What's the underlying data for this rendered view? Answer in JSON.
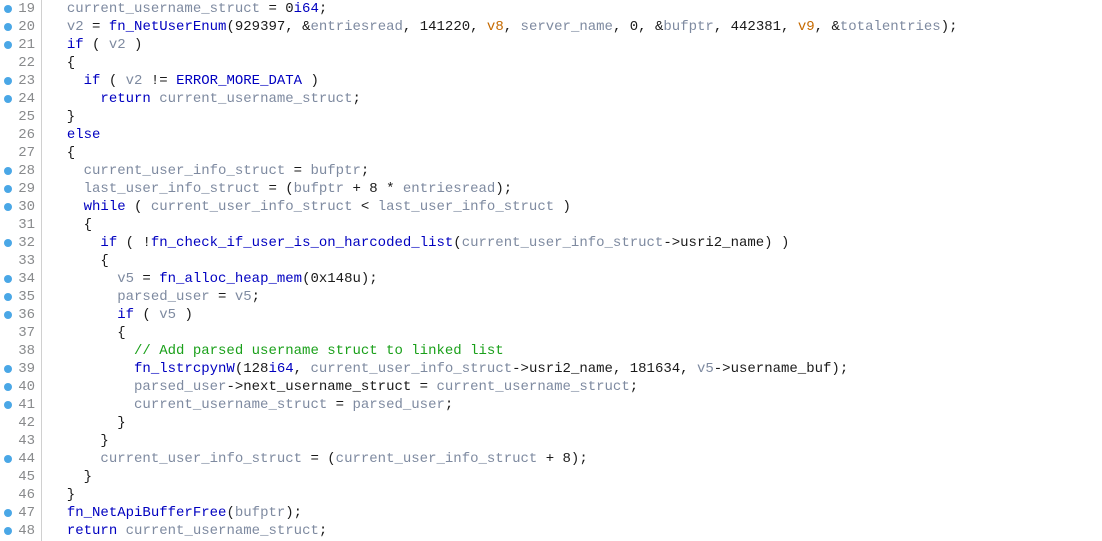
{
  "lines": [
    {
      "num": 19,
      "bp": true,
      "tokens": [
        [
          "  ",
          "sym"
        ],
        [
          "current_username_struct",
          "var"
        ],
        [
          " = 0",
          "sym"
        ],
        [
          "i64",
          "fn"
        ],
        [
          ";",
          "sym"
        ]
      ]
    },
    {
      "num": 20,
      "bp": true,
      "tokens": [
        [
          "  ",
          "sym"
        ],
        [
          "v2",
          "var"
        ],
        [
          " = ",
          "sym"
        ],
        [
          "fn_NetUserEnum",
          "fn"
        ],
        [
          "(929397, &",
          "sym"
        ],
        [
          "entriesread",
          "var"
        ],
        [
          ", 141220, ",
          "sym"
        ],
        [
          "v8",
          "param"
        ],
        [
          ", ",
          "sym"
        ],
        [
          "server_name",
          "var"
        ],
        [
          ", 0, &",
          "sym"
        ],
        [
          "bufptr",
          "var"
        ],
        [
          ", 442381, ",
          "sym"
        ],
        [
          "v9",
          "param"
        ],
        [
          ", &",
          "sym"
        ],
        [
          "totalentries",
          "var"
        ],
        [
          ");",
          "sym"
        ]
      ]
    },
    {
      "num": 21,
      "bp": true,
      "tokens": [
        [
          "  ",
          "sym"
        ],
        [
          "if",
          "kw"
        ],
        [
          " ( ",
          "sym"
        ],
        [
          "v2",
          "var"
        ],
        [
          " )",
          "sym"
        ]
      ]
    },
    {
      "num": 22,
      "bp": false,
      "tokens": [
        [
          "  {",
          "sym"
        ]
      ]
    },
    {
      "num": 23,
      "bp": true,
      "tokens": [
        [
          "    ",
          "sym"
        ],
        [
          "if",
          "kw"
        ],
        [
          " ( ",
          "sym"
        ],
        [
          "v2",
          "var"
        ],
        [
          " != ",
          "sym"
        ],
        [
          "ERROR_MORE_DATA",
          "fn"
        ],
        [
          " )",
          "sym"
        ]
      ]
    },
    {
      "num": 24,
      "bp": true,
      "tokens": [
        [
          "      ",
          "sym"
        ],
        [
          "return",
          "kw"
        ],
        [
          " ",
          "sym"
        ],
        [
          "current_username_struct",
          "var"
        ],
        [
          ";",
          "sym"
        ]
      ]
    },
    {
      "num": 25,
      "bp": false,
      "tokens": [
        [
          "  }",
          "sym"
        ]
      ]
    },
    {
      "num": 26,
      "bp": false,
      "tokens": [
        [
          "  ",
          "sym"
        ],
        [
          "else",
          "kw"
        ]
      ]
    },
    {
      "num": 27,
      "bp": false,
      "tokens": [
        [
          "  {",
          "sym"
        ]
      ]
    },
    {
      "num": 28,
      "bp": true,
      "tokens": [
        [
          "    ",
          "sym"
        ],
        [
          "current_user_info_struct",
          "var"
        ],
        [
          " = ",
          "sym"
        ],
        [
          "bufptr",
          "var"
        ],
        [
          ";",
          "sym"
        ]
      ]
    },
    {
      "num": 29,
      "bp": true,
      "tokens": [
        [
          "    ",
          "sym"
        ],
        [
          "last_user_info_struct",
          "var"
        ],
        [
          " = (",
          "sym"
        ],
        [
          "bufptr",
          "var"
        ],
        [
          " + 8 * ",
          "sym"
        ],
        [
          "entriesread",
          "var"
        ],
        [
          ");",
          "sym"
        ]
      ]
    },
    {
      "num": 30,
      "bp": true,
      "tokens": [
        [
          "    ",
          "sym"
        ],
        [
          "while",
          "kw"
        ],
        [
          " ( ",
          "sym"
        ],
        [
          "current_user_info_struct",
          "var"
        ],
        [
          " < ",
          "sym"
        ],
        [
          "last_user_info_struct",
          "var"
        ],
        [
          " )",
          "sym"
        ]
      ]
    },
    {
      "num": 31,
      "bp": false,
      "tokens": [
        [
          "    {",
          "sym"
        ]
      ]
    },
    {
      "num": 32,
      "bp": true,
      "tokens": [
        [
          "      ",
          "sym"
        ],
        [
          "if",
          "kw"
        ],
        [
          " ( !",
          "sym"
        ],
        [
          "fn_check_if_user_is_on_harcoded_list",
          "fn"
        ],
        [
          "(",
          "sym"
        ],
        [
          "current_user_info_struct",
          "var"
        ],
        [
          "->",
          "sym"
        ],
        [
          "usri2_name",
          "field"
        ],
        [
          ") )",
          "sym"
        ]
      ]
    },
    {
      "num": 33,
      "bp": false,
      "tokens": [
        [
          "      {",
          "sym"
        ]
      ]
    },
    {
      "num": 34,
      "bp": true,
      "tokens": [
        [
          "        ",
          "sym"
        ],
        [
          "v5",
          "var"
        ],
        [
          " = ",
          "sym"
        ],
        [
          "fn_alloc_heap_mem",
          "fn"
        ],
        [
          "(0x148u);",
          "sym"
        ]
      ]
    },
    {
      "num": 35,
      "bp": true,
      "tokens": [
        [
          "        ",
          "sym"
        ],
        [
          "parsed_user",
          "var"
        ],
        [
          " = ",
          "sym"
        ],
        [
          "v5",
          "var"
        ],
        [
          ";",
          "sym"
        ]
      ]
    },
    {
      "num": 36,
      "bp": true,
      "tokens": [
        [
          "        ",
          "sym"
        ],
        [
          "if",
          "kw"
        ],
        [
          " ( ",
          "sym"
        ],
        [
          "v5",
          "var"
        ],
        [
          " )",
          "sym"
        ]
      ]
    },
    {
      "num": 37,
      "bp": false,
      "tokens": [
        [
          "        {",
          "sym"
        ]
      ]
    },
    {
      "num": 38,
      "bp": false,
      "tokens": [
        [
          "          ",
          "sym"
        ],
        [
          "// Add parsed username struct to linked list",
          "cmt"
        ]
      ]
    },
    {
      "num": 39,
      "bp": true,
      "tokens": [
        [
          "          ",
          "sym"
        ],
        [
          "fn_lstrcpynW",
          "fn"
        ],
        [
          "(128",
          "sym"
        ],
        [
          "i64",
          "fn"
        ],
        [
          ", ",
          "sym"
        ],
        [
          "current_user_info_struct",
          "var"
        ],
        [
          "->",
          "sym"
        ],
        [
          "usri2_name",
          "field"
        ],
        [
          ", 181634, ",
          "sym"
        ],
        [
          "v5",
          "var"
        ],
        [
          "->",
          "sym"
        ],
        [
          "username_buf",
          "field"
        ],
        [
          ");",
          "sym"
        ]
      ]
    },
    {
      "num": 40,
      "bp": true,
      "tokens": [
        [
          "          ",
          "sym"
        ],
        [
          "parsed_user",
          "var"
        ],
        [
          "->",
          "sym"
        ],
        [
          "next_username_struct",
          "field"
        ],
        [
          " = ",
          "sym"
        ],
        [
          "current_username_struct",
          "var"
        ],
        [
          ";",
          "sym"
        ]
      ]
    },
    {
      "num": 41,
      "bp": true,
      "tokens": [
        [
          "          ",
          "sym"
        ],
        [
          "current_username_struct",
          "var"
        ],
        [
          " = ",
          "sym"
        ],
        [
          "parsed_user",
          "var"
        ],
        [
          ";",
          "sym"
        ]
      ]
    },
    {
      "num": 42,
      "bp": false,
      "tokens": [
        [
          "        }",
          "sym"
        ]
      ]
    },
    {
      "num": 43,
      "bp": false,
      "tokens": [
        [
          "      }",
          "sym"
        ]
      ]
    },
    {
      "num": 44,
      "bp": true,
      "tokens": [
        [
          "      ",
          "sym"
        ],
        [
          "current_user_info_struct",
          "var"
        ],
        [
          " = (",
          "sym"
        ],
        [
          "current_user_info_struct",
          "var"
        ],
        [
          " + 8);",
          "sym"
        ]
      ]
    },
    {
      "num": 45,
      "bp": false,
      "tokens": [
        [
          "    }",
          "sym"
        ]
      ]
    },
    {
      "num": 46,
      "bp": false,
      "tokens": [
        [
          "  }",
          "sym"
        ]
      ]
    },
    {
      "num": 47,
      "bp": true,
      "tokens": [
        [
          "  ",
          "sym"
        ],
        [
          "fn_NetApiBufferFree",
          "fn"
        ],
        [
          "(",
          "sym"
        ],
        [
          "bufptr",
          "var"
        ],
        [
          ");",
          "sym"
        ]
      ]
    },
    {
      "num": 48,
      "bp": true,
      "tokens": [
        [
          "  ",
          "sym"
        ],
        [
          "return",
          "kw"
        ],
        [
          " ",
          "sym"
        ],
        [
          "current_username_struct",
          "var"
        ],
        [
          ";",
          "sym"
        ]
      ]
    }
  ]
}
